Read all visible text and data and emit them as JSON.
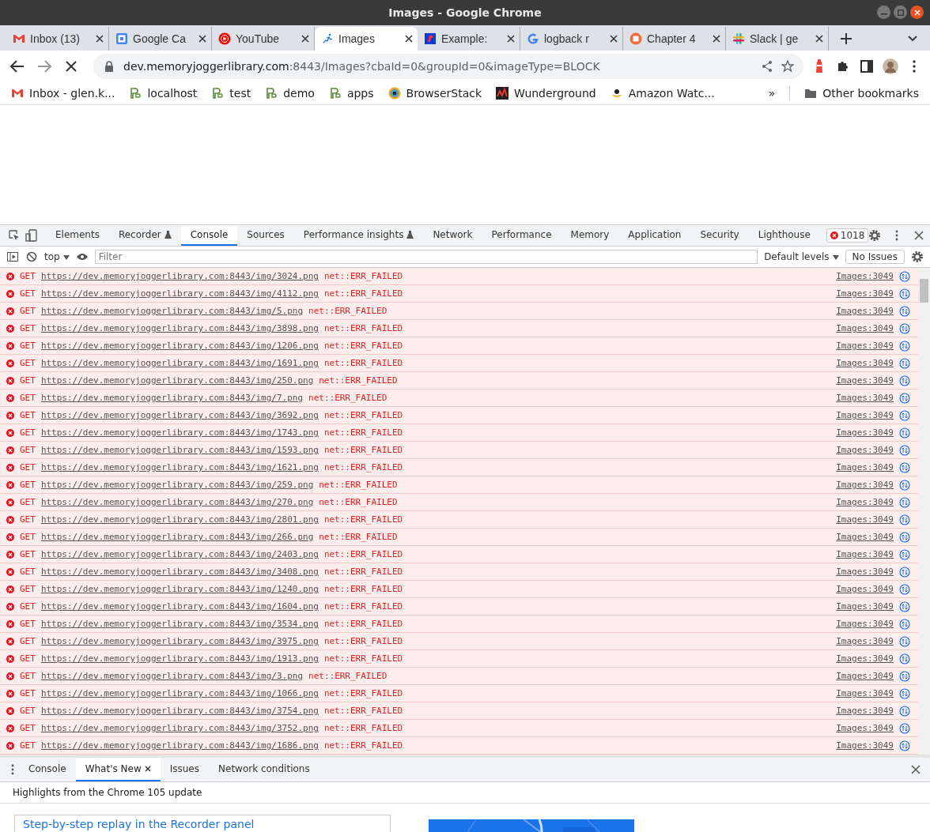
{
  "window": {
    "title": "Images - Google Chrome"
  },
  "tabs": [
    {
      "label": "Inbox (13)",
      "kind": "mail",
      "selected": false
    },
    {
      "label": "Google Ca",
      "kind": "calendar",
      "selected": false
    },
    {
      "label": "YouTube",
      "kind": "video",
      "selected": false
    },
    {
      "label": "Images",
      "kind": "runner",
      "selected": true
    },
    {
      "label": "Example:",
      "kind": "flag",
      "selected": false
    },
    {
      "label": "logback r",
      "kind": "search",
      "selected": false
    },
    {
      "label": "Chapter 4",
      "kind": "book",
      "selected": false
    },
    {
      "label": "Slack | ge",
      "kind": "chat",
      "selected": false
    }
  ],
  "address": {
    "host": "dev.memoryjoggerlibrary.com",
    "rest": ":8443/Images?cbaId=0&groupId=0&imageType=BLOCK"
  },
  "bookmarks": [
    {
      "label": "Inbox - glen.k...",
      "kind": "mail"
    },
    {
      "label": "localhost",
      "kind": "pb"
    },
    {
      "label": "test",
      "kind": "pb"
    },
    {
      "label": "demo",
      "kind": "pb"
    },
    {
      "label": "apps",
      "kind": "pb"
    },
    {
      "label": "BrowserStack",
      "kind": "eye"
    },
    {
      "label": "Wunderground",
      "kind": "wave"
    },
    {
      "label": "Amazon Watc...",
      "kind": "amazon"
    }
  ],
  "bookmarks_overflow": "»",
  "other_bookmarks": "Other bookmarks",
  "devtools": {
    "tabs": [
      {
        "label": "Elements",
        "selected": false,
        "experimental": false
      },
      {
        "label": "Recorder",
        "selected": false,
        "experimental": true
      },
      {
        "label": "Console",
        "selected": true,
        "experimental": false
      },
      {
        "label": "Sources",
        "selected": false,
        "experimental": false
      },
      {
        "label": "Performance insights",
        "selected": false,
        "experimental": true
      },
      {
        "label": "Network",
        "selected": false,
        "experimental": false
      },
      {
        "label": "Performance",
        "selected": false,
        "experimental": false
      },
      {
        "label": "Memory",
        "selected": false,
        "experimental": false
      },
      {
        "label": "Application",
        "selected": false,
        "experimental": false
      },
      {
        "label": "Security",
        "selected": false,
        "experimental": false
      },
      {
        "label": "Lighthouse",
        "selected": false,
        "experimental": false
      }
    ],
    "error_count": "1018",
    "console_toolbar": {
      "context": "top",
      "filter_placeholder": "Filter",
      "levels": "Default levels",
      "issues": "No Issues"
    },
    "messages": [
      {
        "method": "GET",
        "url": "https://dev.memoryjoggerlibrary.com:8443/img/3024.png",
        "error": "net::ERR_FAILED",
        "source": "Images:3049"
      },
      {
        "method": "GET",
        "url": "https://dev.memoryjoggerlibrary.com:8443/img/4112.png",
        "error": "net::ERR_FAILED",
        "source": "Images:3049"
      },
      {
        "method": "GET",
        "url": "https://dev.memoryjoggerlibrary.com:8443/img/5.png",
        "error": "net::ERR_FAILED",
        "source": "Images:3049"
      },
      {
        "method": "GET",
        "url": "https://dev.memoryjoggerlibrary.com:8443/img/3898.png",
        "error": "net::ERR_FAILED",
        "source": "Images:3049"
      },
      {
        "method": "GET",
        "url": "https://dev.memoryjoggerlibrary.com:8443/img/1206.png",
        "error": "net::ERR_FAILED",
        "source": "Images:3049"
      },
      {
        "method": "GET",
        "url": "https://dev.memoryjoggerlibrary.com:8443/img/1691.png",
        "error": "net::ERR_FAILED",
        "source": "Images:3049"
      },
      {
        "method": "GET",
        "url": "https://dev.memoryjoggerlibrary.com:8443/img/250.png",
        "error": "net::ERR_FAILED",
        "source": "Images:3049"
      },
      {
        "method": "GET",
        "url": "https://dev.memoryjoggerlibrary.com:8443/img/7.png",
        "error": "net::ERR_FAILED",
        "source": "Images:3049"
      },
      {
        "method": "GET",
        "url": "https://dev.memoryjoggerlibrary.com:8443/img/3692.png",
        "error": "net::ERR_FAILED",
        "source": "Images:3049"
      },
      {
        "method": "GET",
        "url": "https://dev.memoryjoggerlibrary.com:8443/img/1743.png",
        "error": "net::ERR_FAILED",
        "source": "Images:3049"
      },
      {
        "method": "GET",
        "url": "https://dev.memoryjoggerlibrary.com:8443/img/1593.png",
        "error": "net::ERR_FAILED",
        "source": "Images:3049"
      },
      {
        "method": "GET",
        "url": "https://dev.memoryjoggerlibrary.com:8443/img/1621.png",
        "error": "net::ERR_FAILED",
        "source": "Images:3049"
      },
      {
        "method": "GET",
        "url": "https://dev.memoryjoggerlibrary.com:8443/img/259.png",
        "error": "net::ERR_FAILED",
        "source": "Images:3049"
      },
      {
        "method": "GET",
        "url": "https://dev.memoryjoggerlibrary.com:8443/img/270.png",
        "error": "net::ERR_FAILED",
        "source": "Images:3049"
      },
      {
        "method": "GET",
        "url": "https://dev.memoryjoggerlibrary.com:8443/img/2801.png",
        "error": "net::ERR_FAILED",
        "source": "Images:3049"
      },
      {
        "method": "GET",
        "url": "https://dev.memoryjoggerlibrary.com:8443/img/266.png",
        "error": "net::ERR_FAILED",
        "source": "Images:3049"
      },
      {
        "method": "GET",
        "url": "https://dev.memoryjoggerlibrary.com:8443/img/2403.png",
        "error": "net::ERR_FAILED",
        "source": "Images:3049"
      },
      {
        "method": "GET",
        "url": "https://dev.memoryjoggerlibrary.com:8443/img/3408.png",
        "error": "net::ERR_FAILED",
        "source": "Images:3049"
      },
      {
        "method": "GET",
        "url": "https://dev.memoryjoggerlibrary.com:8443/img/1240.png",
        "error": "net::ERR_FAILED",
        "source": "Images:3049"
      },
      {
        "method": "GET",
        "url": "https://dev.memoryjoggerlibrary.com:8443/img/1604.png",
        "error": "net::ERR_FAILED",
        "source": "Images:3049"
      },
      {
        "method": "GET",
        "url": "https://dev.memoryjoggerlibrary.com:8443/img/3534.png",
        "error": "net::ERR_FAILED",
        "source": "Images:3049"
      },
      {
        "method": "GET",
        "url": "https://dev.memoryjoggerlibrary.com:8443/img/3975.png",
        "error": "net::ERR_FAILED",
        "source": "Images:3049"
      },
      {
        "method": "GET",
        "url": "https://dev.memoryjoggerlibrary.com:8443/img/1913.png",
        "error": "net::ERR_FAILED",
        "source": "Images:3049"
      },
      {
        "method": "GET",
        "url": "https://dev.memoryjoggerlibrary.com:8443/img/3.png",
        "error": "net::ERR_FAILED",
        "source": "Images:3049"
      },
      {
        "method": "GET",
        "url": "https://dev.memoryjoggerlibrary.com:8443/img/1066.png",
        "error": "net::ERR_FAILED",
        "source": "Images:3049"
      },
      {
        "method": "GET",
        "url": "https://dev.memoryjoggerlibrary.com:8443/img/3754.png",
        "error": "net::ERR_FAILED",
        "source": "Images:3049"
      },
      {
        "method": "GET",
        "url": "https://dev.memoryjoggerlibrary.com:8443/img/3752.png",
        "error": "net::ERR_FAILED",
        "source": "Images:3049"
      },
      {
        "method": "GET",
        "url": "https://dev.memoryjoggerlibrary.com:8443/img/1686.png",
        "error": "net::ERR_FAILED",
        "source": "Images:3049"
      }
    ]
  },
  "drawer": {
    "tabs": [
      {
        "label": "Console",
        "selected": false,
        "closable": false
      },
      {
        "label": "What's New",
        "selected": true,
        "closable": true
      },
      {
        "label": "Issues",
        "selected": false,
        "closable": false
      },
      {
        "label": "Network conditions",
        "selected": false,
        "closable": false
      }
    ],
    "heading": "Highlights from the Chrome 105 update",
    "card_title": "Step-by-step replay in the Recorder panel"
  }
}
